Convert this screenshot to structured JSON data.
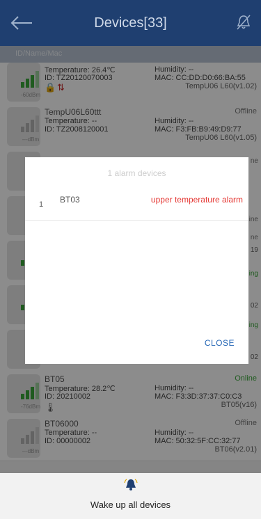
{
  "header": {
    "title": "Devices[33]"
  },
  "search": {
    "placeholder": "ID/Name/Mac"
  },
  "devices": [
    {
      "name": "",
      "status": "",
      "temperature_label": "Temperature: 26.4℃",
      "id": "ID: TZ20120070003",
      "humidity_label": "Humidity: --",
      "mac": "MAC: CC:DD:D0:66:BA:55",
      "model": "TempU06 L60(v1.02)",
      "dbm": "-60dBm"
    },
    {
      "name": "TempU06L60ttt",
      "status": "Offline",
      "temperature_label": "Temperature: --",
      "id": "ID: TZ2008120001",
      "humidity_label": "Humidity: --",
      "mac": "MAC: F3:FB:B9:49:D9:77",
      "model": "TempU06 L60(v1.05)",
      "dbm": "---dBm"
    },
    {
      "name": "BT05",
      "status": "Online",
      "temperature_label": "Temperature: 28.2℃",
      "id": "ID: 20210002",
      "humidity_label": "Humidity: --",
      "mac": "MAC: F3:3D:37:37:C0:C3",
      "model": "BT05(v16)",
      "dbm": "-76dBm"
    },
    {
      "name": "BT06000",
      "status": "Offline",
      "temperature_label": "Temperature: --",
      "id": "ID: 00000002",
      "humidity_label": "Humidity: --",
      "mac": "MAC: 50:32:5F:CC:32:77",
      "model": "BT06(v2.01)",
      "dbm": "---dBm"
    }
  ],
  "edge_fragments": [
    "ne",
    "ine",
    "ne",
    "19",
    "ing",
    "02",
    "ing",
    "02"
  ],
  "dialog": {
    "title": "1 alarm devices",
    "items": [
      {
        "index": "1",
        "name": "BT03",
        "alarm": "upper temperature alarm"
      }
    ],
    "close_label": "CLOSE"
  },
  "footer": {
    "wake_label": "Wake up all devices"
  },
  "colors": {
    "header": "#1f3f70",
    "online": "#3aa63a",
    "offline": "#777777",
    "alarm": "#e53935",
    "close": "#2466b5"
  }
}
